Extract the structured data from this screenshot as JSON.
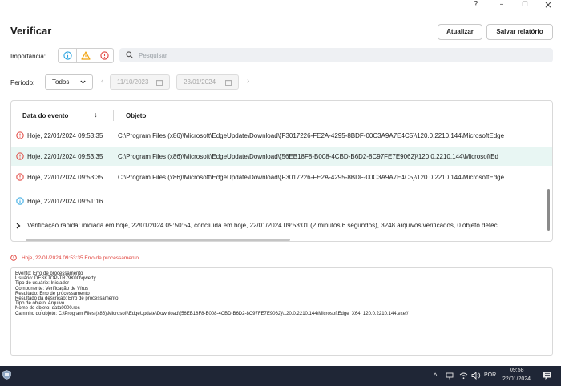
{
  "window": {
    "help": "?",
    "minimize": "–",
    "restore": "❐",
    "close": "×"
  },
  "page": {
    "title": "Verificar",
    "update_button": "Atualizar",
    "save_report_button": "Salvar relatório"
  },
  "filters": {
    "importance_label": "Importância:",
    "search_placeholder": "Pesquisar",
    "period_label": "Período:",
    "period_value": "Todos",
    "start_date": "11/10/2023",
    "end_date": "23/01/2024"
  },
  "table": {
    "columns": {
      "date": "Data do evento",
      "sort_arrow": "↓",
      "object": "Objeto"
    },
    "rows": [
      {
        "level": "error",
        "date": "Hoje, 22/01/2024 09:53:35",
        "object": "C:\\Program Files (x86)\\Microsoft\\EdgeUpdate\\Download\\{F3017226-FE2A-4295-8BDF-00C3A9A7E4C5}\\120.0.2210.144\\MicrosoftEdge"
      },
      {
        "level": "error",
        "date": "Hoje, 22/01/2024 09:53:35",
        "object": "C:\\Program Files (x86)\\Microsoft\\EdgeUpdate\\Download\\{56EB18F8-B008-4CBD-B6D2-8C97FE7E9062}\\120.0.2210.144\\MicrosoftEd"
      },
      {
        "level": "error",
        "date": "Hoje, 22/01/2024 09:53:35",
        "object": "C:\\Program Files (x86)\\Microsoft\\EdgeUpdate\\Download\\{F3017226-FE2A-4295-8BDF-00C3A9A7E4C5}\\120.0.2210.144\\MicrosoftEdge"
      },
      {
        "level": "info",
        "date": "Hoje, 22/01/2024 09:51:16",
        "object": ""
      }
    ],
    "summary": "Verificação rápida: iniciada em hoje, 22/01/2024 09:50:54, concluída em hoje, 22/01/2024 09:53:01 (2 minutos 6 segundos), 3248 arquivos verificados, 0 objeto detec"
  },
  "detail": {
    "heading": "Hoje, 22/01/2024 09:53:35 Erro de processamento",
    "lines": [
      "Evento: Erro de processamento",
      "Usuário: DESKTOP-TR79K0O\\qwerty",
      "Tipo de usuário: Iniciador",
      "Componente: Verificação de Vírus",
      "Resultado: Erro de processamento",
      "Resultado da descrição: Erro de processamento",
      "Tipo de objeto: Arquivo",
      "Nome do objeto: data0000.res",
      "Caminho do objeto: C:\\Program Files (x86)\\Microsoft\\EdgeUpdate\\Download\\{56EB18F8-B008-4CBD-B6D2-8C97FE7E9062}\\120.0.2210.144\\MicrosoftEdge_X64_120.0.2210.144.exe//"
    ]
  },
  "taskbar": {
    "language": "POR",
    "time": "09:58",
    "date": "22/01/2024"
  },
  "colors": {
    "error": "#e0403a",
    "warning": "#f2a20c",
    "info": "#29a3e0",
    "selected_row": "#e8f6f3",
    "taskbar": "#1f2636"
  }
}
